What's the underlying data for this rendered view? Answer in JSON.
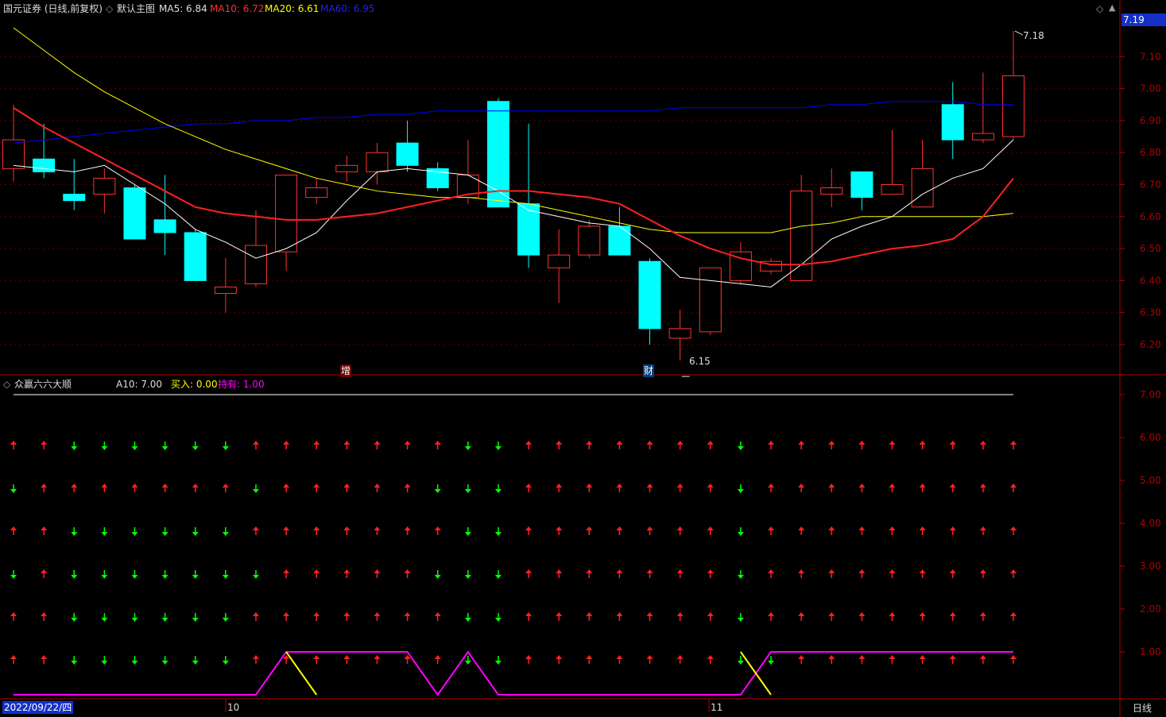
{
  "header": {
    "stock_title": "国元证券 (日线,前复权)",
    "template_label": "默认主图",
    "ma5_label": "MA5: 6.84",
    "ma10_label": "MA10: 6.72",
    "ma20_label": "MA20: 6.61",
    "ma60_label": "MA60: 6.95",
    "current_price_tag": "7.19"
  },
  "colors": {
    "up": "#ff3232",
    "down": "#00ffff",
    "ma5": "#ffffff",
    "ma10": "#ff2020",
    "ma20": "#ffff00",
    "ma60": "#0000ff",
    "axis": "#b00000",
    "hold": "#ff00ff",
    "buy": "#ffff00",
    "arrow_up": "#ff2020",
    "arrow_down": "#00ff00"
  },
  "indicator": {
    "name": "众赢六六大顺",
    "a10_label": "A10: 7.00",
    "buy_label": "买入: 0.00",
    "hold_label": "持有: 1.00"
  },
  "footer": {
    "date_label": "2022/09/22/四",
    "month_oct": "10",
    "month_nov": "11",
    "period_button": "日线"
  },
  "annotations": {
    "high_label": "7.18",
    "low_label": "6.15",
    "event_zeng": "增",
    "event_cai": "财"
  },
  "chart_data": [
    {
      "type": "candlestick",
      "title": "",
      "ylim": [
        6.15,
        7.2
      ],
      "y_ticks": [
        "7.10",
        "7.00",
        "6.90",
        "6.80",
        "6.70",
        "6.60",
        "6.50",
        "6.40",
        "6.30",
        "6.20"
      ],
      "candles": [
        {
          "o": 6.75,
          "h": 6.95,
          "l": 6.71,
          "c": 6.84
        },
        {
          "o": 6.78,
          "h": 6.89,
          "l": 6.72,
          "c": 6.74
        },
        {
          "o": 6.67,
          "h": 6.78,
          "l": 6.62,
          "c": 6.65
        },
        {
          "o": 6.67,
          "h": 6.75,
          "l": 6.61,
          "c": 6.72
        },
        {
          "o": 6.69,
          "h": 6.7,
          "l": 6.53,
          "c": 6.53
        },
        {
          "o": 6.59,
          "h": 6.73,
          "l": 6.48,
          "c": 6.55
        },
        {
          "o": 6.55,
          "h": 6.56,
          "l": 6.4,
          "c": 6.4
        },
        {
          "o": 6.36,
          "h": 6.47,
          "l": 6.3,
          "c": 6.38
        },
        {
          "o": 6.39,
          "h": 6.62,
          "l": 6.38,
          "c": 6.51
        },
        {
          "o": 6.49,
          "h": 6.73,
          "l": 6.43,
          "c": 6.73
        },
        {
          "o": 6.66,
          "h": 6.72,
          "l": 6.64,
          "c": 6.69
        },
        {
          "o": 6.74,
          "h": 6.79,
          "l": 6.71,
          "c": 6.76
        },
        {
          "o": 6.74,
          "h": 6.83,
          "l": 6.7,
          "c": 6.8
        },
        {
          "o": 6.83,
          "h": 6.9,
          "l": 6.74,
          "c": 6.76
        },
        {
          "o": 6.75,
          "h": 6.77,
          "l": 6.68,
          "c": 6.69
        },
        {
          "o": 6.66,
          "h": 6.84,
          "l": 6.64,
          "c": 6.73
        },
        {
          "o": 6.96,
          "h": 6.97,
          "l": 6.63,
          "c": 6.63
        },
        {
          "o": 6.64,
          "h": 6.89,
          "l": 6.44,
          "c": 6.48
        },
        {
          "o": 6.44,
          "h": 6.56,
          "l": 6.33,
          "c": 6.48
        },
        {
          "o": 6.48,
          "h": 6.59,
          "l": 6.47,
          "c": 6.57
        },
        {
          "o": 6.57,
          "h": 6.63,
          "l": 6.48,
          "c": 6.48
        },
        {
          "o": 6.46,
          "h": 6.47,
          "l": 6.2,
          "c": 6.25
        },
        {
          "o": 6.22,
          "h": 6.31,
          "l": 6.15,
          "c": 6.25
        },
        {
          "o": 6.24,
          "h": 6.44,
          "l": 6.23,
          "c": 6.44
        },
        {
          "o": 6.4,
          "h": 6.52,
          "l": 6.39,
          "c": 6.49
        },
        {
          "o": 6.43,
          "h": 6.47,
          "l": 6.42,
          "c": 6.46
        },
        {
          "o": 6.4,
          "h": 6.73,
          "l": 6.4,
          "c": 6.68
        },
        {
          "o": 6.67,
          "h": 6.75,
          "l": 6.63,
          "c": 6.69
        },
        {
          "o": 6.74,
          "h": 6.74,
          "l": 6.62,
          "c": 6.66
        },
        {
          "o": 6.67,
          "h": 6.87,
          "l": 6.67,
          "c": 6.7
        },
        {
          "o": 6.63,
          "h": 6.84,
          "l": 6.63,
          "c": 6.75
        },
        {
          "o": 6.95,
          "h": 7.02,
          "l": 6.78,
          "c": 6.84
        },
        {
          "o": 6.84,
          "h": 7.05,
          "l": 6.83,
          "c": 6.86
        },
        {
          "o": 6.85,
          "h": 7.18,
          "l": 6.84,
          "c": 7.04
        }
      ],
      "ma5": [
        6.76,
        6.75,
        6.74,
        6.76,
        6.7,
        6.64,
        6.56,
        6.52,
        6.47,
        6.5,
        6.55,
        6.65,
        6.74,
        6.75,
        6.74,
        6.73,
        6.68,
        6.62,
        6.6,
        6.58,
        6.57,
        6.5,
        6.41,
        6.4,
        6.39,
        6.38,
        6.45,
        6.53,
        6.57,
        6.6,
        6.67,
        6.72,
        6.75,
        6.84
      ],
      "ma10": [
        6.94,
        6.88,
        6.83,
        6.78,
        6.73,
        6.68,
        6.63,
        6.61,
        6.6,
        6.59,
        6.59,
        6.6,
        6.61,
        6.63,
        6.65,
        6.67,
        6.68,
        6.68,
        6.67,
        6.66,
        6.64,
        6.59,
        6.54,
        6.5,
        6.47,
        6.45,
        6.45,
        6.46,
        6.48,
        6.5,
        6.51,
        6.53,
        6.6,
        6.72
      ],
      "ma20": [
        7.19,
        7.12,
        7.05,
        6.99,
        6.94,
        6.89,
        6.85,
        6.81,
        6.78,
        6.75,
        6.72,
        6.7,
        6.68,
        6.67,
        6.66,
        6.66,
        6.65,
        6.64,
        6.62,
        6.6,
        6.58,
        6.56,
        6.55,
        6.55,
        6.55,
        6.55,
        6.57,
        6.58,
        6.6,
        6.6,
        6.6,
        6.6,
        6.6,
        6.61
      ],
      "ma60": [
        6.83,
        6.84,
        6.85,
        6.86,
        6.87,
        6.88,
        6.89,
        6.89,
        6.9,
        6.9,
        6.91,
        6.91,
        6.92,
        6.92,
        6.93,
        6.93,
        6.93,
        6.93,
        6.93,
        6.93,
        6.93,
        6.93,
        6.94,
        6.94,
        6.94,
        6.94,
        6.94,
        6.95,
        6.95,
        6.96,
        6.96,
        6.96,
        6.95,
        6.95
      ]
    },
    {
      "type": "indicator",
      "title": "众赢六六大顺",
      "ylim": [
        0,
        7.5
      ],
      "y_ticks": [
        "7.00",
        "6.00",
        "5.00",
        "4.00",
        "3.00",
        "2.00",
        "1.00"
      ],
      "a10": 7.0,
      "arrow_rows": [
        "1100000011111110011111110111111111",
        "0111111101111100011111110111111111",
        "1100000011111110011111110111111111",
        "0100000001111100011111110111111111",
        "1100000011111110011111110111111111",
        "1100000011111110011111110011111111"
      ],
      "hold": [
        0,
        0,
        0,
        0,
        0,
        0,
        0,
        0,
        0,
        1,
        1,
        1,
        1,
        1,
        0,
        1,
        0,
        0,
        0,
        0,
        0,
        0,
        0,
        0,
        0,
        1,
        1,
        1,
        1,
        1,
        1,
        1,
        1,
        1
      ],
      "buy_segments": [
        [
          9,
          10
        ],
        [
          24,
          25
        ]
      ]
    }
  ]
}
